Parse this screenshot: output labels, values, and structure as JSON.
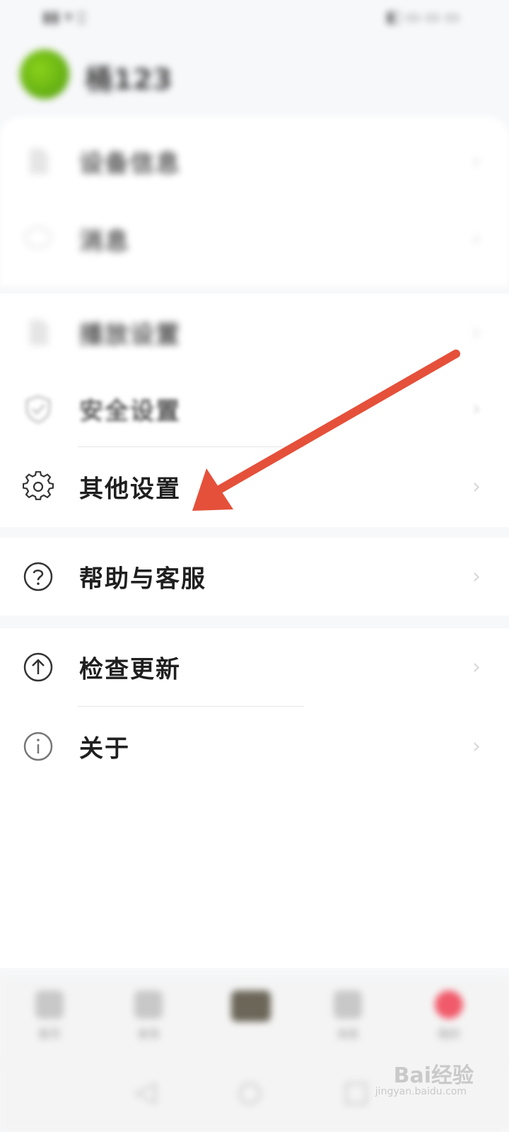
{
  "status_bar": {
    "left": "▮▮ ▾ ▯",
    "right": "◧ ▭ ▭ ▭"
  },
  "profile": {
    "username": "桶123"
  },
  "menu": {
    "section1": [
      {
        "label": "设备信息",
        "icon": "document-icon"
      },
      {
        "label": "消息",
        "icon": "chat-icon"
      }
    ],
    "section2": [
      {
        "label": "播放设置",
        "icon": "file-icon"
      },
      {
        "label": "安全设置",
        "icon": "shield-check-icon"
      },
      {
        "label": "其他设置",
        "icon": "gear-icon"
      }
    ],
    "section3": [
      {
        "label": "帮助与客服",
        "icon": "help-circle-icon"
      }
    ],
    "section4": [
      {
        "label": "检查更新",
        "icon": "upload-circle-icon"
      },
      {
        "label": "关于",
        "icon": "info-circle-icon"
      }
    ],
    "chevron": "›"
  },
  "bottom_nav": [
    "首页",
    "发现",
    "",
    "消息",
    "我的"
  ],
  "watermark": {
    "brand": "Bai经验",
    "url": "jingyan.baidu.com"
  },
  "colors": {
    "arrow": "#e5503a",
    "active_tab": "#f15a6a"
  }
}
